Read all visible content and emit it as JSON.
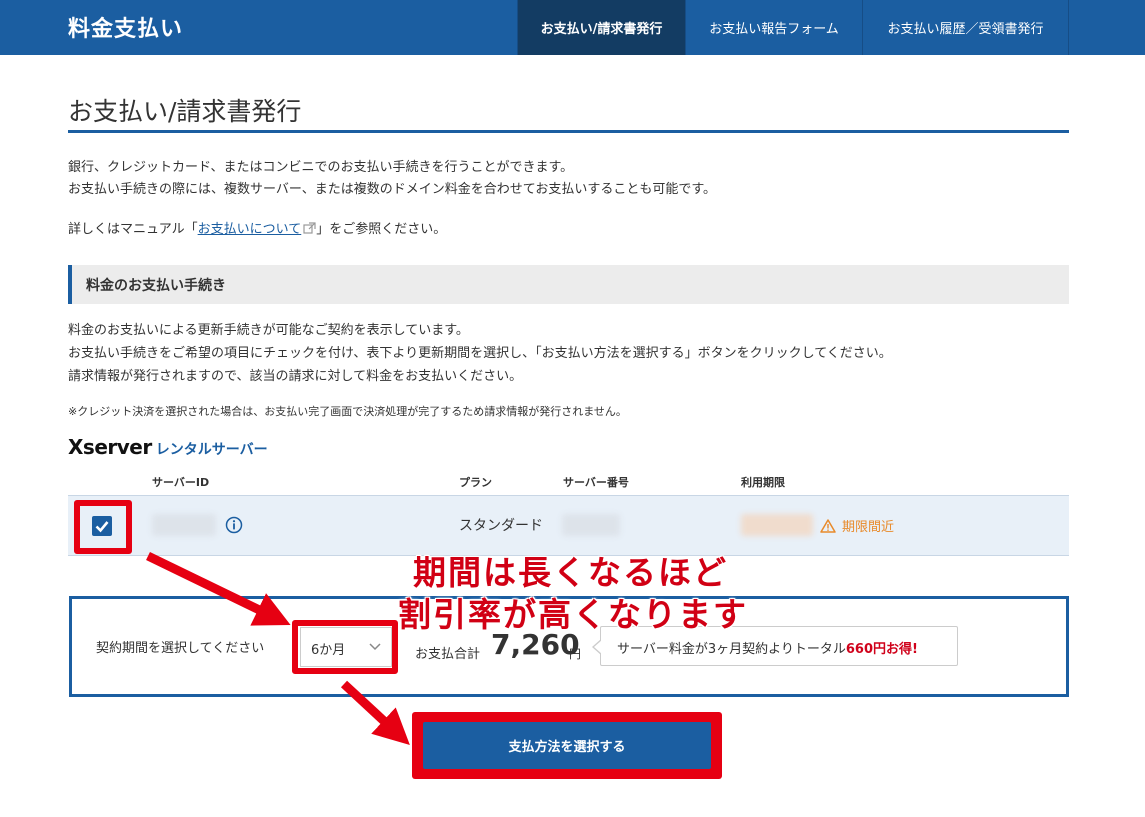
{
  "header": {
    "app_title": "料金支払い",
    "nav": [
      {
        "label": "お支払い/請求書発行",
        "active": true
      },
      {
        "label": "お支払い報告フォーム",
        "active": false
      },
      {
        "label": "お支払い履歴／受領書発行",
        "active": false
      }
    ]
  },
  "page": {
    "title": "お支払い/請求書発行",
    "intro_line1": "銀行、クレジットカード、またはコンビニでのお支払い手続きを行うことができます。",
    "intro_line2": "お支払い手続きの際には、複数サーバー、または複数のドメイン料金を合わせてお支払いすることも可能です。",
    "manual_prefix": "詳しくはマニュアル「",
    "manual_link": "お支払いについて",
    "manual_suffix": "」をご参照ください。"
  },
  "section": {
    "heading": "料金のお支払い手続き",
    "desc_line1": "料金のお支払いによる更新手続きが可能なご契約を表示しています。",
    "desc_line2": "お支払い手続きをご希望の項目にチェックを付け、表下より更新期間を選択し、「お支払い方法を選択する」ボタンをクリックしてください。",
    "desc_line3": "請求情報が発行されますので、該当の請求に対して料金をお支払いください。",
    "note": "※クレジット決済を選択された場合は、お支払い完了画面で決済処理が完了するため請求情報が発行されません。"
  },
  "brand": {
    "main": "Xserver",
    "sub": "レンタルサーバー"
  },
  "table": {
    "headers": [
      "サーバーID",
      "プラン",
      "サーバー番号",
      "利用期限"
    ],
    "row": {
      "checked": true,
      "plan": "スタンダード",
      "status": "期限間近"
    }
  },
  "contract": {
    "period_label": "契約期間を選択してください",
    "period_value": "6か月",
    "total_label": "お支払合計",
    "total_amount": "7,260",
    "total_unit": "円",
    "bubble_prefix": "サーバー料金が3ヶ月契約よりトータル",
    "bubble_highlight": "660円お得!"
  },
  "submit_label": "支払方法を選択する",
  "annotation": {
    "line1": "期間は長くなるほど",
    "line2": "割引率が高くなります"
  },
  "colors": {
    "brand_blue": "#1b5ea1",
    "annotation_red": "#e60012",
    "warning_orange": "#e88a2a"
  }
}
